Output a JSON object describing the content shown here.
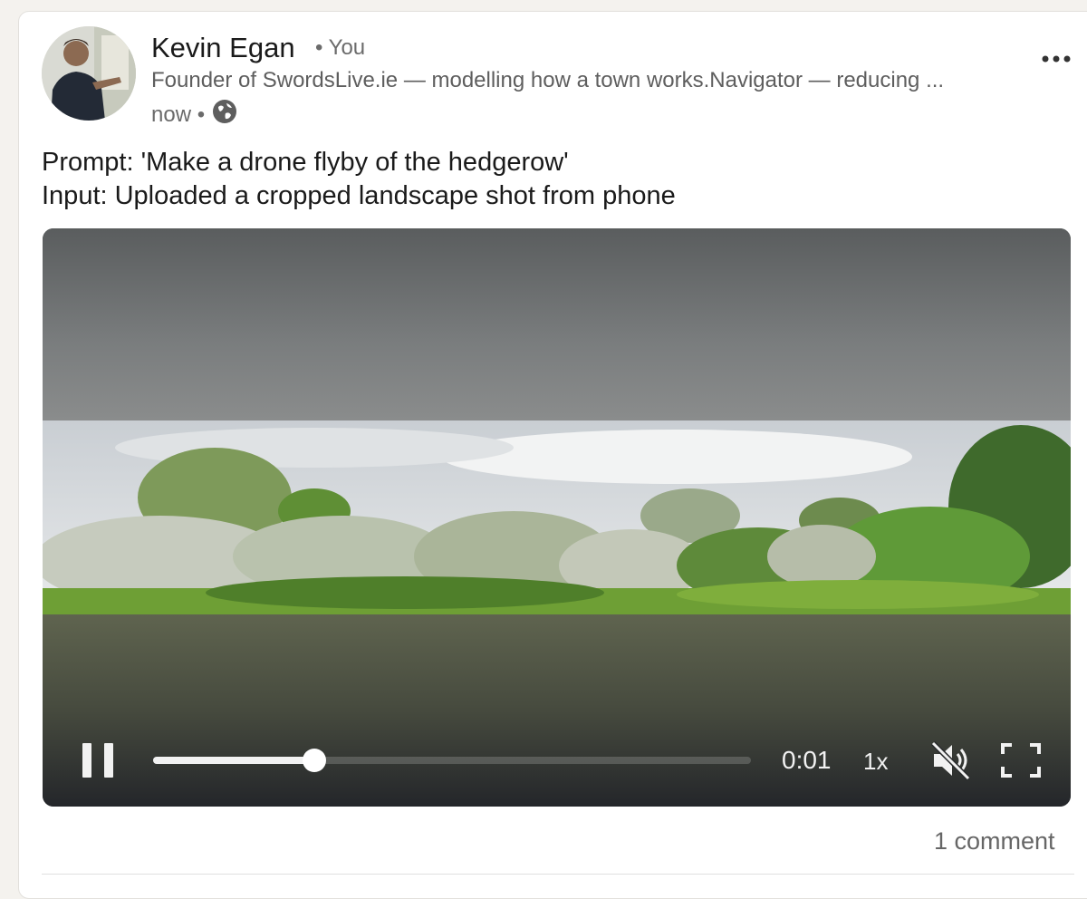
{
  "post": {
    "author_name": "Kevin Egan",
    "you_badge": "• You",
    "headline": "Founder of SwordsLive.ie — modelling how a town works.Navigator — reducing ...",
    "timestamp": "now •",
    "visibility_icon": "globe-icon",
    "menu_icon": "more-options-icon",
    "text_line_1": "Prompt: 'Make a drone flyby of the hedgerow'",
    "text_line_2": "Input: Uploaded a cropped landscape shot from phone"
  },
  "video": {
    "elapsed": "0:01",
    "speed": "1x",
    "progress": 0.27,
    "muted": true,
    "icons": [
      "pause-icon",
      "mute-icon",
      "fullscreen-icon"
    ]
  },
  "footer": {
    "comment_count": "1 comment"
  },
  "colors": {
    "card_bg": "#ffffff",
    "page_bg": "#f4f2ee",
    "secondary_text": "#666666"
  }
}
